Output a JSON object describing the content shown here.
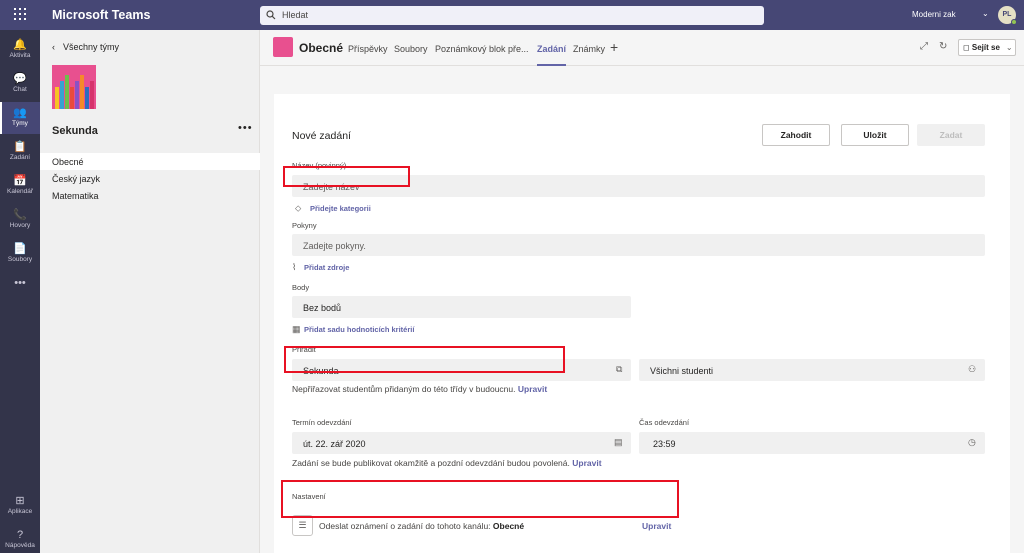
{
  "app": {
    "title": "Microsoft Teams",
    "search_placeholder": "Hledat",
    "user_name": "Moderni zak",
    "user_initials": "PL"
  },
  "rail": [
    {
      "label": "Aktivita",
      "icon": "bell-icon",
      "glyph": "🔔"
    },
    {
      "label": "Chat",
      "icon": "chat-icon",
      "glyph": "💬"
    },
    {
      "label": "Týmy",
      "icon": "teams-icon",
      "glyph": "👥"
    },
    {
      "label": "Zadání",
      "icon": "assignments-icon",
      "glyph": "📋"
    },
    {
      "label": "Kalendář",
      "icon": "calendar-icon",
      "glyph": "📅"
    },
    {
      "label": "Hovory",
      "icon": "phone-icon",
      "glyph": "📞"
    },
    {
      "label": "Soubory",
      "icon": "files-icon",
      "glyph": "📄"
    },
    {
      "label": "",
      "icon": "more-icon",
      "glyph": "•••"
    }
  ],
  "rail_bottom": [
    {
      "label": "Aplikace",
      "icon": "apps-icon",
      "glyph": "⊞"
    },
    {
      "label": "Nápověda",
      "icon": "help-icon",
      "glyph": "?"
    }
  ],
  "team_panel": {
    "back_label": "Všechny týmy",
    "team_name": "Sekunda",
    "more": "•••",
    "channels": [
      "Obecné",
      "Český jazyk",
      "Matematika"
    ]
  },
  "channel_header": {
    "name": "Obecné",
    "tabs": [
      "Příspěvky",
      "Soubory",
      "Poznámkový blok pře...",
      "Zadání",
      "Známky"
    ],
    "active_tab": "Zadání",
    "meet_label": "Sejít se"
  },
  "form": {
    "title": "Nové zadání",
    "buttons": {
      "discard": "Zahodit",
      "save": "Uložit",
      "assign": "Zadat"
    },
    "name_label": "Název (povinný)",
    "name_placeholder": "Zadejte název",
    "category_link": "Přidejte kategorii",
    "instructions_label": "Pokyny",
    "instructions_placeholder": "Zadejte pokyny.",
    "resources_link": "Přidat zdroje",
    "points_label": "Body",
    "points_value": "Bez bodů",
    "rubric_link": "Přidat sadu hodnoticích kritérií",
    "assign_label": "Přiřadit",
    "assign_class": "Sekunda",
    "assign_students": "Všichni studenti",
    "future_note": "Nepřiřazovat studentům přidaným do této třídy v budoucnu.",
    "future_edit": "Upravit",
    "due_date_label": "Termín odevzdání",
    "due_date_value": "út. 22. zář 2020",
    "due_time_label": "Čas odevzdání",
    "due_time_value": "23:59",
    "publish_note": "Zadání se bude publikovat okamžitě a pozdní odevzdání budou povolená.",
    "publish_edit": "Upravit",
    "settings_label": "Nastavení",
    "notify_text": "Odeslat oznámení o zadání do tohoto kanálu:",
    "notify_channel": "Obecné",
    "notify_edit": "Upravit"
  },
  "colors": {
    "brand": "#464775",
    "accent": "#6264a7",
    "highlight": "#e81123"
  }
}
